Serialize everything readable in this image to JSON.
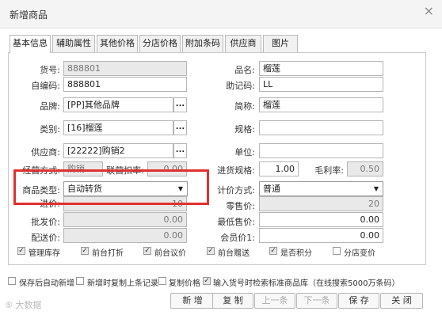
{
  "dialog": {
    "title": "新增商品",
    "close_glyph": "×"
  },
  "tabs": [
    "基本信息",
    "辅助属性",
    "其他价格",
    "分店价格",
    "附加条码",
    "供应商",
    "图片"
  ],
  "fields": {
    "huohao": {
      "label": "货号:",
      "value": "888801"
    },
    "zibianma": {
      "label": "自编码:",
      "value": "888801"
    },
    "pinpai": {
      "label": "品牌:",
      "value": "[PP]其他品牌"
    },
    "leibie": {
      "label": "类别:",
      "value": "[16]榴莲"
    },
    "gongyingshang": {
      "label": "供应商:",
      "value": "[22222]购销2"
    },
    "jingying": {
      "label": "经营方式:",
      "value": "购销"
    },
    "lianying": {
      "label": "联营扣率:",
      "value": "0.00"
    },
    "leixing": {
      "label": "商品类型:",
      "value": "自动转货"
    },
    "jinjia": {
      "label": "进价:",
      "value": "10"
    },
    "pifa": {
      "label": "批发价:",
      "value": "0.00"
    },
    "peisong": {
      "label": "配送价:",
      "value": "0.00"
    },
    "pinming": {
      "label": "品名:",
      "value": "榴莲"
    },
    "zhujima": {
      "label": "助记码:",
      "value": "LL"
    },
    "jiancheng": {
      "label": "简称:",
      "value": "榴莲"
    },
    "guige": {
      "label": "规格:",
      "value": ""
    },
    "danwei": {
      "label": "单位:",
      "value": ""
    },
    "jinhuoguige": {
      "label": "进货规格:",
      "value": "1.00"
    },
    "maolilv": {
      "label": "毛利率:",
      "value": "0.50"
    },
    "jijia": {
      "label": "计价方式:",
      "value": "普通"
    },
    "lingshou": {
      "label": "零售价:",
      "value": "20"
    },
    "zuidi": {
      "label": "最低售价:",
      "value": "0.00"
    },
    "huiyuan": {
      "label": "会员价1:",
      "value": "0.00"
    }
  },
  "dots": "...",
  "arrow": "▼",
  "check_glyph": "✓",
  "options": [
    {
      "label": "管理库存",
      "checked": true
    },
    {
      "label": "前台打折",
      "checked": true
    },
    {
      "label": "前台议价",
      "checked": true
    },
    {
      "label": "前台赠送",
      "checked": true
    },
    {
      "label": "是否积分",
      "checked": true
    },
    {
      "label": "分店变价",
      "checked": false
    }
  ],
  "bottom_options": [
    {
      "label": "保存后自动新增",
      "checked": false
    },
    {
      "label": "新增时复制上条记录",
      "checked": false
    },
    {
      "label": "复制价格",
      "checked": false
    },
    {
      "label": "输入货号时检索标准商品库（在线搜索5000万条码）",
      "checked": true
    }
  ],
  "buttons": {
    "new": "新 增",
    "copy": "复 制",
    "prev": "上一条",
    "next": "下一条",
    "save": "保 存",
    "close": "关 闭"
  },
  "watermark": "⑤ 大数据"
}
